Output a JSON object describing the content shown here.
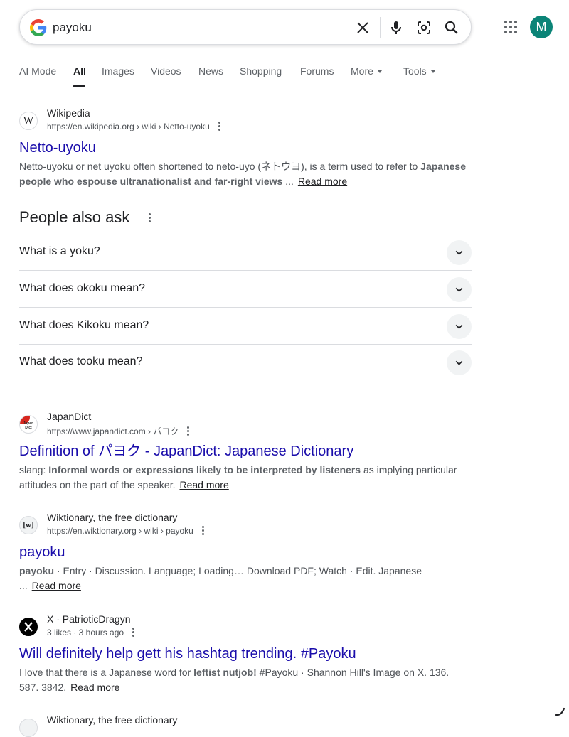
{
  "search": {
    "query": "payoku"
  },
  "header": {
    "avatar_letter": "M"
  },
  "tabs": [
    {
      "label": "AI Mode"
    },
    {
      "label": "All"
    },
    {
      "label": "Images"
    },
    {
      "label": "Videos"
    },
    {
      "label": "News"
    },
    {
      "label": "Shopping"
    },
    {
      "label": "Forums"
    },
    {
      "label": "More"
    },
    {
      "label": "Tools"
    }
  ],
  "results": [
    {
      "site": "Wikipedia",
      "icon_text": "W",
      "url": "https://en.wikipedia.org › wiki › Netto-uyoku",
      "title": "Netto-uyoku",
      "snippet_plain": "Netto-uyoku or net uyoku often shortened to neto-uyo (ネトウヨ), is a term used to refer to ",
      "snippet_bold": "Japanese people who espouse ultranationalist and far-right views",
      "snippet_tail": " ...",
      "read_more": "Read more"
    },
    {
      "site": "JapanDict",
      "icon_text": "Japan Dict",
      "url": "https://www.japandict.com › パヨク",
      "title": "Definition of パヨク - JapanDict: Japanese Dictionary",
      "snippet_lead": "slang: ",
      "snippet_bold": "Informal words or expressions likely to be interpreted by listeners",
      "snippet_tail": " as implying particular attitudes on the part of the speaker.",
      "read_more": "Read more"
    },
    {
      "site": "Wiktionary, the free dictionary",
      "icon_text": "[w]",
      "url": "https://en.wiktionary.org › wiki › payoku",
      "title": "payoku",
      "snippet_bold": "payoku",
      "snippet_tail": " · Entry · Discussion. Language; Loading… Download PDF; Watch · Edit. Japanese ...",
      "read_more": "Read more"
    },
    {
      "site": "X · PatrioticDragyn",
      "meta": "3 likes · 3 hours ago",
      "title": "Will definitely help gett his hashtag trending. #Payoku",
      "snippet_lead": "I love that there is a Japanese word for ",
      "snippet_bold": "leftist nutjob!",
      "snippet_tail": " #Payoku · Shannon Hill's Image on X. 136. 587. 3842.",
      "read_more": "Read more"
    },
    {
      "site": "Wiktionary, the free dictionary"
    }
  ],
  "paa": {
    "heading": "People also ask",
    "questions": [
      "What is a yoku?",
      "What does okoku mean?",
      "What does Kikoku mean?",
      "What does tooku mean?"
    ]
  }
}
